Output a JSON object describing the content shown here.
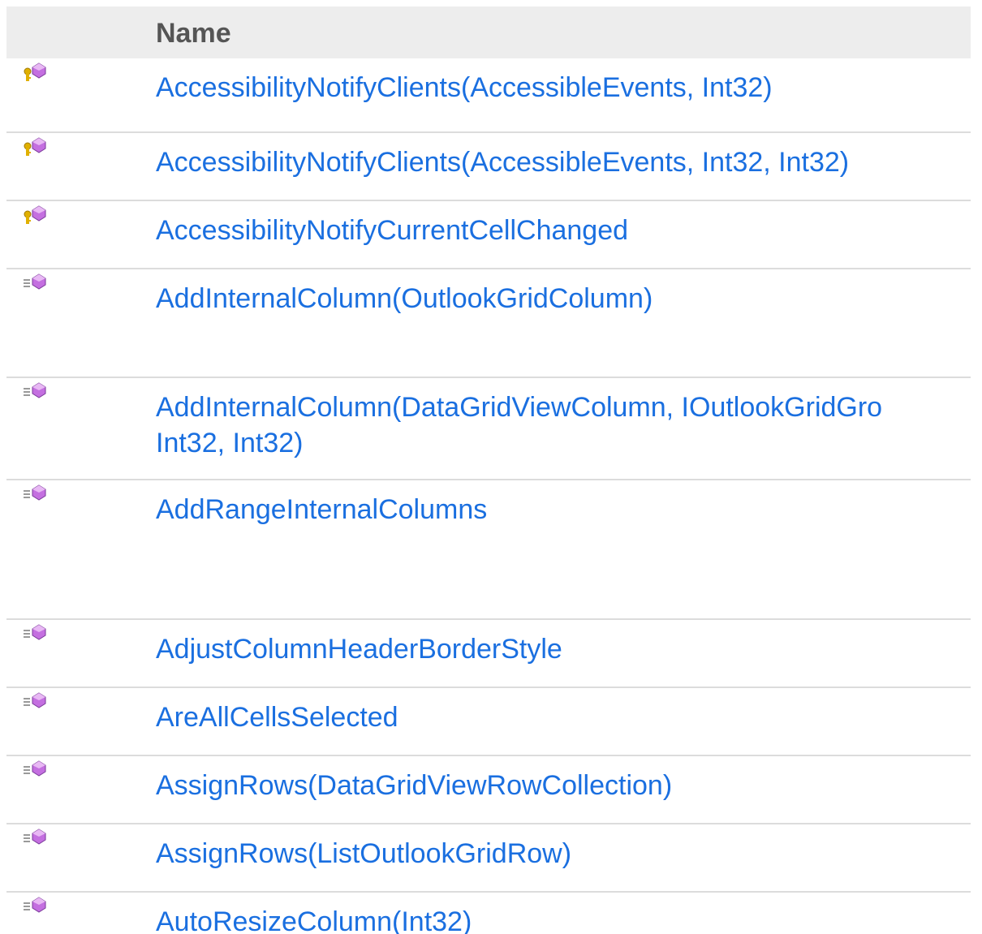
{
  "table": {
    "header": {
      "icon_col": "",
      "name_col": "Name"
    },
    "rows": [
      {
        "icon": "protected-method-icon",
        "name": "AccessibilityNotifyClients(AccessibleEvents, Int32)"
      },
      {
        "icon": "protected-method-icon",
        "name": "AccessibilityNotifyClients(AccessibleEvents, Int32, Int32)"
      },
      {
        "icon": "protected-method-icon",
        "name": "AccessibilityNotifyCurrentCellChanged"
      },
      {
        "icon": "public-method-icon",
        "name": "AddInternalColumn(OutlookGridColumn)"
      },
      {
        "icon": "public-method-icon",
        "name": "AddInternalColumn(DataGridViewColumn, IOutlookGridGro"
      },
      {
        "icon": "public-method-icon",
        "name": "AddRangeInternalColumns"
      },
      {
        "icon": "public-method-icon",
        "name": "AdjustColumnHeaderBorderStyle"
      },
      {
        "icon": "public-method-icon",
        "name": "AreAllCellsSelected"
      },
      {
        "icon": "public-method-icon",
        "name": "AssignRows(DataGridViewRowCollection)"
      },
      {
        "icon": "public-method-icon",
        "name": "AssignRows(ListOutlookGridRow)"
      },
      {
        "icon": "public-method-icon",
        "name": "AutoResizeColumn(Int32)"
      }
    ],
    "wrapped_row_second_line": "Int32, Int32)"
  },
  "colors": {
    "link": "#1a6fe0",
    "header_bg": "#ededed",
    "header_text": "#555555",
    "divider": "#dcdcdc",
    "method_icon": "#b35fd6"
  }
}
